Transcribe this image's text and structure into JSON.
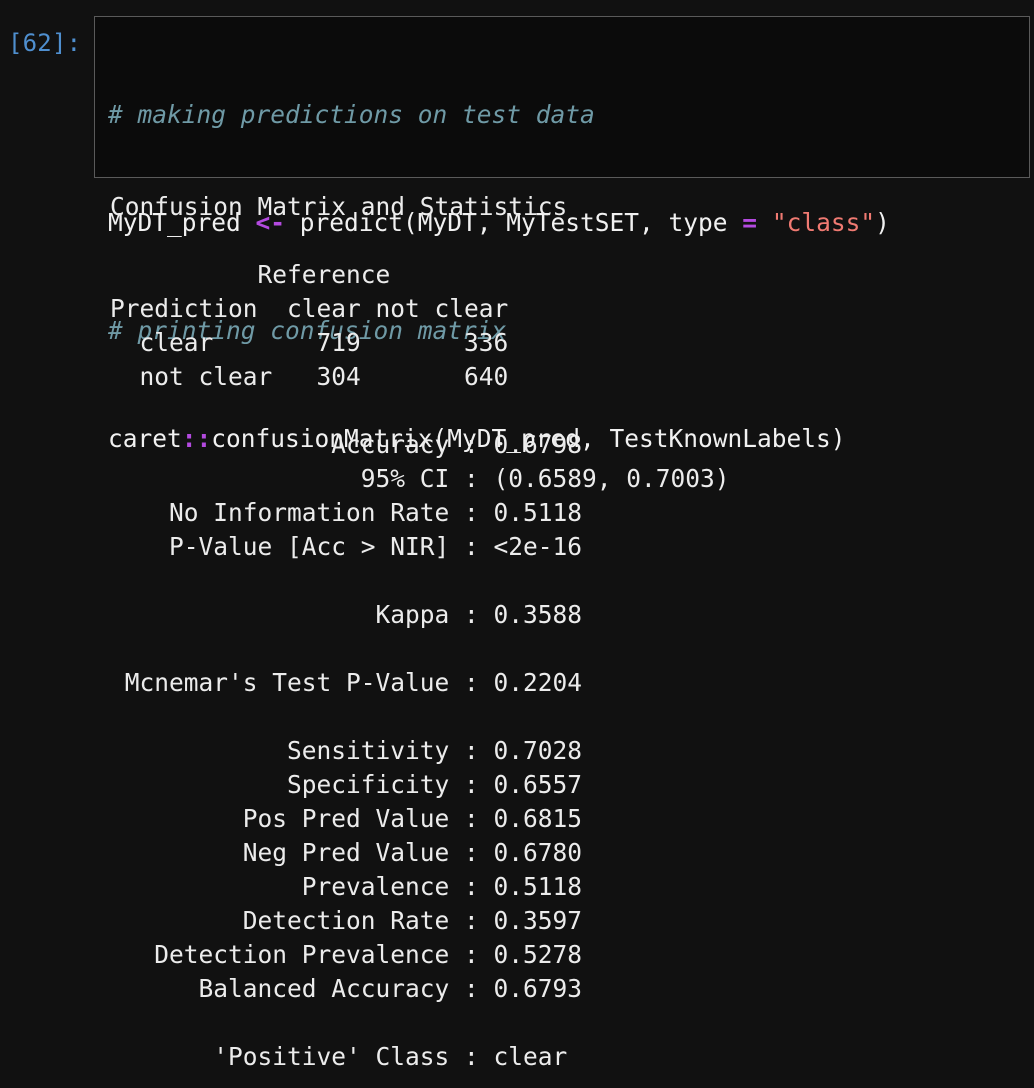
{
  "cell": {
    "prompt": "[62]:",
    "code": {
      "line1_comment": "# making predictions on test data",
      "line2": {
        "var": "MyDT_pred ",
        "assign_op": "<-",
        "call_open": " predict(MyDT, MyTestSET, type ",
        "eq_op": "=",
        "space": " ",
        "string": "\"class\"",
        "close": ")"
      },
      "line3_comment": "# printing confusion matrix",
      "line4": {
        "pkg": "caret",
        "ns_op": "::",
        "call": "confusionMatrix(MyDT_pred, TestKnownLabels)"
      }
    }
  },
  "output": {
    "lines": [
      "Confusion Matrix and Statistics",
      "",
      "          Reference",
      "Prediction  clear not clear",
      "  clear       719       336",
      "  not clear   304       640",
      "",
      "               Accuracy : 0.6798",
      "                 95% CI : (0.6589, 0.7003)",
      "    No Information Rate : 0.5118",
      "    P-Value [Acc > NIR] : <2e-16",
      "",
      "                  Kappa : 0.3588",
      "",
      " Mcnemar's Test P-Value : 0.2204",
      "",
      "            Sensitivity : 0.7028",
      "            Specificity : 0.6557",
      "         Pos Pred Value : 0.6815",
      "         Neg Pred Value : 0.6780",
      "             Prevalence : 0.5118",
      "         Detection Rate : 0.3597",
      "   Detection Prevalence : 0.5278",
      "      Balanced Accuracy : 0.6793",
      "",
      "       'Positive' Class : clear"
    ]
  },
  "colors": {
    "background": "#111111",
    "prompt": "#4f8fcf",
    "comment": "#6f9aa6",
    "operator": "#b44ae0",
    "string": "#f07a72",
    "text": "#ececec"
  }
}
